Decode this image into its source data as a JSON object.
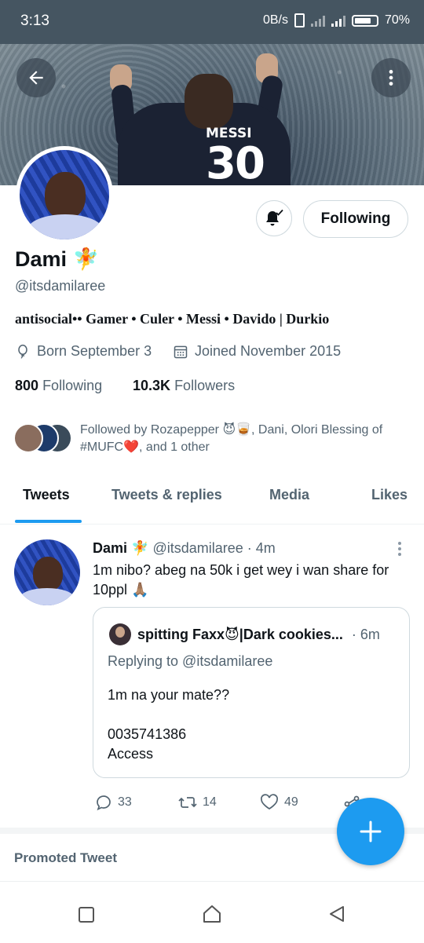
{
  "status_bar": {
    "time": "3:13",
    "net_speed": "0B/s",
    "battery": "70%"
  },
  "banner": {
    "jersey_name": "MESSI",
    "jersey_number": "30"
  },
  "profile": {
    "name": "Dami 🧚",
    "handle": "@itsdamilaree",
    "bio": "antisocial•• Gamer • Culer • Messi • Davido | Durkio",
    "born": "Born September 3",
    "joined": "Joined November 2015",
    "following_count": "800",
    "following_label": "Following",
    "followers_count": "10.3K",
    "followers_label": "Followers",
    "followed_by": "Followed by Rozapepper 😈🥃, Dani, Olori Blessing of #MUFC❤️, and 1 other",
    "follow_button": "Following"
  },
  "tabs": [
    {
      "label": "Tweets"
    },
    {
      "label": "Tweets & replies"
    },
    {
      "label": "Media"
    },
    {
      "label": "Likes"
    }
  ],
  "tweet": {
    "author_name": "Dami 🧚",
    "author_handle": "@itsdamilaree · 4m",
    "text": "1m nibo?  abeg na 50k i get wey i wan share for 10ppl 🙏🏽",
    "quote": {
      "author_name": "spitting Faxx😈|Dark cookies...",
      "time": "· 6m",
      "replying": "Replying to @itsdamilaree",
      "line1": "1m na your mate??",
      "line2": "0035741386",
      "line3": "Access"
    },
    "replies": "33",
    "retweets": "14",
    "likes": "49"
  },
  "promoted_label": "Promoted Tweet",
  "colors": {
    "accent": "#1d9bf0",
    "status_bar": "#455561",
    "secondary_text": "#536471"
  }
}
